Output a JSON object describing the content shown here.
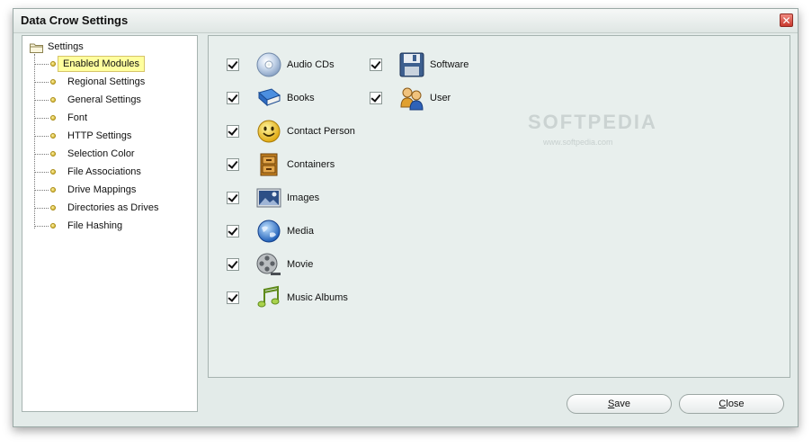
{
  "window": {
    "title": "Data Crow Settings",
    "close_glyph": "✕"
  },
  "tree": {
    "root_label": "Settings",
    "items": [
      {
        "label": "Enabled Modules",
        "selected": true
      },
      {
        "label": "Regional Settings"
      },
      {
        "label": "General Settings"
      },
      {
        "label": "Font"
      },
      {
        "label": "HTTP Settings"
      },
      {
        "label": "Selection Color"
      },
      {
        "label": "File Associations"
      },
      {
        "label": "Drive Mappings"
      },
      {
        "label": "Directories as Drives"
      },
      {
        "label": "File Hashing"
      }
    ]
  },
  "modules": {
    "column1": [
      {
        "label": "Audio CDs",
        "checked": true,
        "icon": "cd-icon"
      },
      {
        "label": "Books",
        "checked": true,
        "icon": "book-icon"
      },
      {
        "label": "Contact Person",
        "checked": true,
        "icon": "smiley-icon"
      },
      {
        "label": "Containers",
        "checked": true,
        "icon": "cabinet-icon"
      },
      {
        "label": "Images",
        "checked": true,
        "icon": "image-icon"
      },
      {
        "label": "Media",
        "checked": true,
        "icon": "globe-icon"
      },
      {
        "label": "Movie",
        "checked": true,
        "icon": "film-reel-icon"
      },
      {
        "label": "Music Albums",
        "checked": true,
        "icon": "music-note-icon"
      }
    ],
    "column2": [
      {
        "label": "Software",
        "checked": true,
        "icon": "floppy-disk-icon"
      },
      {
        "label": "User",
        "checked": true,
        "icon": "users-icon"
      }
    ]
  },
  "buttons": {
    "save_mnemonic": "S",
    "save_rest": "ave",
    "close_mnemonic": "C",
    "close_rest": "lose"
  },
  "watermark": {
    "logo": "SOFTPEDIA",
    "url": "www.softpedia.com"
  }
}
